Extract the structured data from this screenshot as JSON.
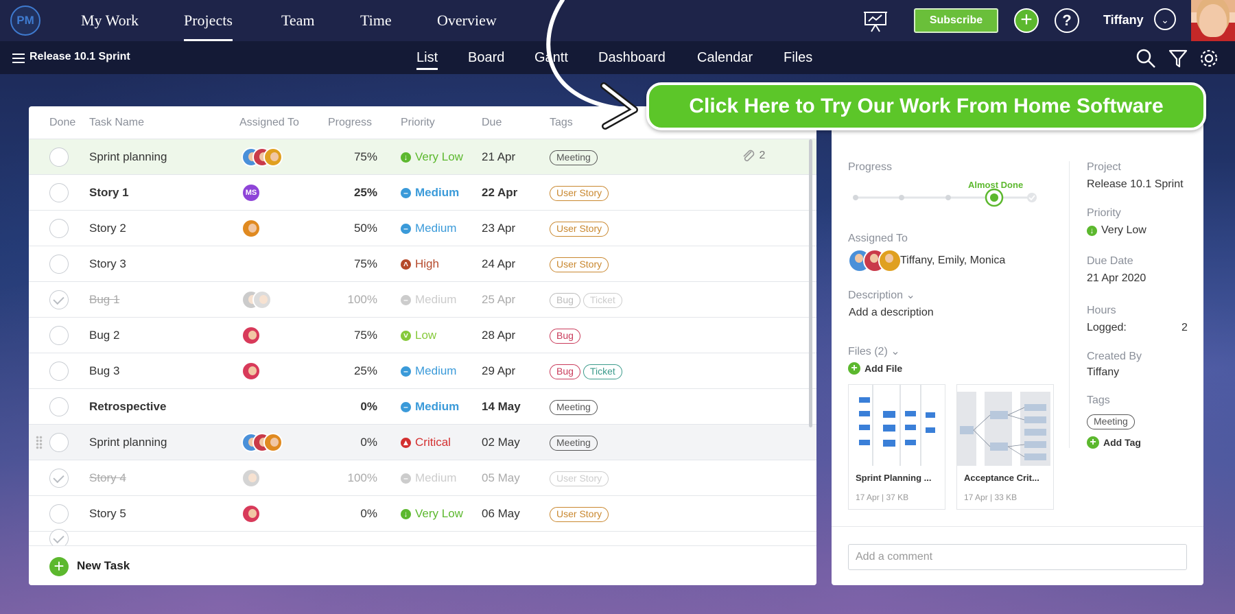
{
  "app": {
    "logo": "PM",
    "username": "Tiffany"
  },
  "topnav": [
    {
      "label": "My Work"
    },
    {
      "label": "Projects"
    },
    {
      "label": "Team"
    },
    {
      "label": "Time"
    },
    {
      "label": "Overview"
    }
  ],
  "subscribe_label": "Subscribe",
  "subbar": {
    "project": "Release 10.1 Sprint",
    "tabs": [
      {
        "label": "List"
      },
      {
        "label": "Board"
      },
      {
        "label": "Gantt"
      },
      {
        "label": "Dashboard"
      },
      {
        "label": "Calendar"
      },
      {
        "label": "Files"
      }
    ]
  },
  "table": {
    "headers": [
      "Done",
      "Task Name",
      "Assigned To",
      "Progress",
      "Priority",
      "Due",
      "Tags"
    ],
    "rows": [
      {
        "name": "Sprint planning",
        "progress": "75%",
        "priority": "Very Low",
        "due": "21 Apr",
        "tags": [
          "Meeting"
        ],
        "attachments": "2"
      },
      {
        "name": "Story 1",
        "progress": "25%",
        "priority": "Medium",
        "due": "22 Apr",
        "tags": [
          "User Story"
        ],
        "initials": "MS"
      },
      {
        "name": "Story 2",
        "progress": "50%",
        "priority": "Medium",
        "due": "23 Apr",
        "tags": [
          "User Story"
        ]
      },
      {
        "name": "Story 3",
        "progress": "75%",
        "priority": "High",
        "due": "24 Apr",
        "tags": [
          "User Story"
        ]
      },
      {
        "name": "Bug 1",
        "progress": "100%",
        "priority": "Medium",
        "due": "25 Apr",
        "tags": [
          "Bug",
          "Ticket"
        ]
      },
      {
        "name": "Bug 2",
        "progress": "75%",
        "priority": "Low",
        "due": "28 Apr",
        "tags": [
          "Bug"
        ]
      },
      {
        "name": "Bug 3",
        "progress": "25%",
        "priority": "Medium",
        "due": "29 Apr",
        "tags": [
          "Bug",
          "Ticket"
        ]
      },
      {
        "name": "Retrospective",
        "progress": "0%",
        "priority": "Medium",
        "due": "14 May",
        "tags": [
          "Meeting"
        ]
      },
      {
        "name": "Sprint planning",
        "progress": "0%",
        "priority": "Critical",
        "due": "02 May",
        "tags": [
          "Meeting"
        ]
      },
      {
        "name": "Story 4",
        "progress": "100%",
        "priority": "Medium",
        "due": "05 May",
        "tags": [
          "User Story"
        ]
      },
      {
        "name": "Story 5",
        "progress": "0%",
        "priority": "Very Low",
        "due": "06 May",
        "tags": [
          "User Story"
        ]
      }
    ],
    "new_task": "New Task"
  },
  "detail": {
    "progress_label": "Progress",
    "progress_status": "Almost Done",
    "assigned_label": "Assigned To",
    "assigned_names": "Tiffany, Emily, Monica",
    "description_label": "Description",
    "description_placeholder": "Add a description",
    "files_label": "Files (2)",
    "add_file": "Add File",
    "files": [
      {
        "name": "Sprint Planning ...",
        "meta": "17 Apr | 37 KB"
      },
      {
        "name": "Acceptance Crit...",
        "meta": "17 Apr | 33 KB"
      }
    ],
    "project_label": "Project",
    "project_value": "Release 10.1 Sprint",
    "priority_label": "Priority",
    "priority_value": "Very Low",
    "due_label": "Due Date",
    "due_value": "21 Apr 2020",
    "hours_label": "Hours",
    "logged_label": "Logged:",
    "logged_value": "2",
    "created_label": "Created By",
    "created_value": "Tiffany",
    "tags_label": "Tags",
    "tag_value": "Meeting",
    "add_tag": "Add Tag",
    "comment_placeholder": "Add a comment"
  },
  "cta": "Click Here to Try Our Work From Home Software",
  "colors": {
    "brand_green": "#5cb82e",
    "navy": "#1e2449",
    "very_low": "#5cb82e",
    "medium": "#3a9ad9",
    "high": "#b5492a",
    "critical": "#d33030",
    "low": "#86c93b",
    "tag_user_story": "#c9872e",
    "tag_bug": "#c93a5a",
    "tag_ticket": "#3a9a8a"
  }
}
